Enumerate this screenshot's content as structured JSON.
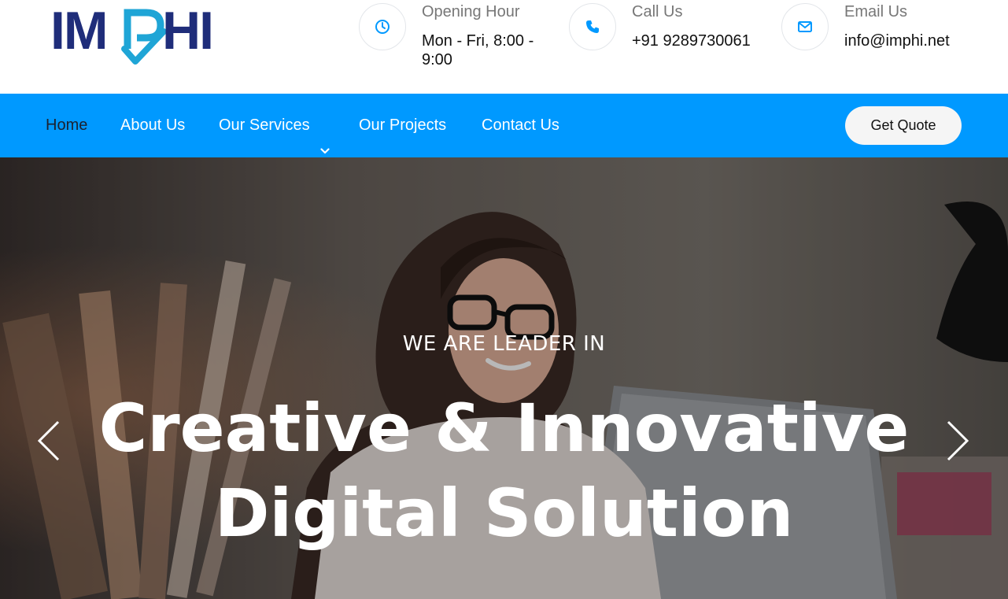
{
  "brand": {
    "logo_text": "IMPHI",
    "colors": {
      "navy": "#1f2d7a",
      "teal": "#1fa5d6"
    }
  },
  "contact_info": {
    "hours": {
      "label": "Opening Hour",
      "value_line1": "Mon - Fri, 8:00 -",
      "value_line2": "9:00",
      "icon": "clock-icon"
    },
    "phone": {
      "label": "Call Us",
      "value": "+91 9289730061",
      "icon": "phone-icon"
    },
    "email": {
      "label": "Email Us",
      "value": "info@imphi.net",
      "icon": "envelope-icon"
    }
  },
  "nav": {
    "items": [
      {
        "label": "Home",
        "active": true
      },
      {
        "label": "About Us",
        "active": false
      },
      {
        "label": "Our Services",
        "active": false,
        "dropdown": true
      },
      {
        "label": "Our Projects",
        "active": false
      },
      {
        "label": "Contact Us",
        "active": false
      }
    ],
    "cta_label": "Get Quote",
    "background": "#0099ff"
  },
  "hero": {
    "eyebrow": "WE ARE LEADER IN",
    "title_line1": "Creative & Innovative",
    "title_line2": "Digital Solution",
    "prev_icon": "chevron-left-icon",
    "next_icon": "chevron-right-icon"
  }
}
